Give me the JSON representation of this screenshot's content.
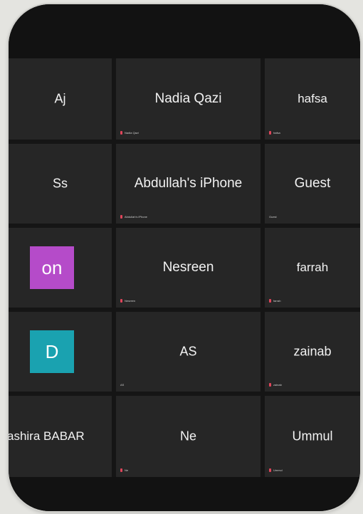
{
  "colors": {
    "tile_background": "#262626",
    "device_background": "#151515",
    "mic_muted": "#e0455a",
    "avatar_on": "#b54bc9",
    "avatar_d": "#1aa2b0"
  },
  "participants": [
    {
      "name": "Aj",
      "label": ""
    },
    {
      "name": "Nadia Qazi",
      "label": "Nadia Qazi"
    },
    {
      "name": "hafsa",
      "label": "hafsa"
    },
    {
      "name": "Ss",
      "label": ""
    },
    {
      "name": "Abdullah's iPhone",
      "label": "Abdullah's iPhone"
    },
    {
      "name": "Guest",
      "label": "Guest"
    },
    {
      "name": "",
      "label": "",
      "avatar": "on",
      "avatar_color": "#b54bc9"
    },
    {
      "name": "Nesreen",
      "label": "Nesreen"
    },
    {
      "name": "farrah",
      "label": "farrah"
    },
    {
      "name": "",
      "label": "",
      "avatar": "D",
      "avatar_color": "#1aa2b0"
    },
    {
      "name": "AS",
      "label": "AS"
    },
    {
      "name": "zainab",
      "label": "zainab"
    },
    {
      "name": "ashira BABAR",
      "label": ""
    },
    {
      "name": "Ne",
      "label": "Ne"
    },
    {
      "name": "Ummul",
      "label": "Ummul"
    }
  ]
}
